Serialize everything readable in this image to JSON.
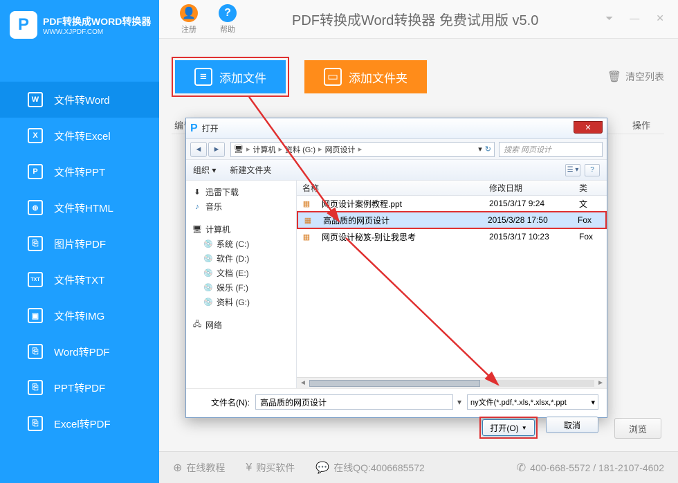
{
  "logo": {
    "letter": "P",
    "title": "PDF转换成WORD转换器",
    "url": "WWW.XJPDF.COM"
  },
  "header": {
    "register": "注册",
    "help": "帮助",
    "title": "PDF转换成Word转换器 免费试用版 v5.0"
  },
  "sidebar": {
    "items": [
      {
        "icon": "W",
        "label": "文件转Word"
      },
      {
        "icon": "X",
        "label": "文件转Excel"
      },
      {
        "icon": "P",
        "label": "文件转PPT"
      },
      {
        "icon": "⊕",
        "label": "文件转HTML"
      },
      {
        "icon": "⎘",
        "label": "图片转PDF"
      },
      {
        "icon": "TXT",
        "label": "文件转TXT"
      },
      {
        "icon": "▣",
        "label": "文件转IMG"
      },
      {
        "icon": "⎘",
        "label": "Word转PDF"
      },
      {
        "icon": "⎘",
        "label": "PPT转PDF"
      },
      {
        "icon": "⎘",
        "label": "Excel转PDF"
      }
    ]
  },
  "toolbar": {
    "add_file": "添加文件",
    "add_folder": "添加文件夹",
    "clear_list": "清空列表"
  },
  "table_headers": {
    "seq": "编号",
    "op": "操作"
  },
  "browse": "浏览",
  "footer": {
    "tutorial": "在线教程",
    "buy": "购买软件",
    "qq": "在线QQ:4006685572",
    "phone": "400-668-5572 / 181-2107-4602"
  },
  "dialog": {
    "title": "打开",
    "breadcrumb": [
      "计算机",
      "资料 (G:)",
      "网页设计"
    ],
    "search_placeholder": "搜索 网页设计",
    "toolbar": {
      "organize": "组织",
      "new_folder": "新建文件夹"
    },
    "tree": {
      "group1": "迅雷下载",
      "group2": "音乐",
      "computer": "计算机",
      "drives": [
        "系统 (C:)",
        "软件 (D:)",
        "文档 (E:)",
        "娱乐 (F:)",
        "资料 (G:)"
      ],
      "network": "网络"
    },
    "list": {
      "cols": {
        "name": "名称",
        "date": "修改日期",
        "type": "类"
      },
      "rows": [
        {
          "name": "网页设计案例教程.ppt",
          "date": "2015/3/17 9:24",
          "type": "文"
        },
        {
          "name": "高品质的网页设计",
          "date": "2015/3/28 17:50",
          "type": "Fox"
        },
        {
          "name": "网页设计秘笈-别让我思考",
          "date": "2015/3/17 10:23",
          "type": "Fox"
        }
      ]
    },
    "filename_label": "文件名(N):",
    "filename_value": "高品质的网页设计",
    "filetype": "ny文件(*.pdf,*.xls,*.xlsx,*.ppt",
    "open_btn": "打开(O)",
    "cancel_btn": "取消"
  }
}
